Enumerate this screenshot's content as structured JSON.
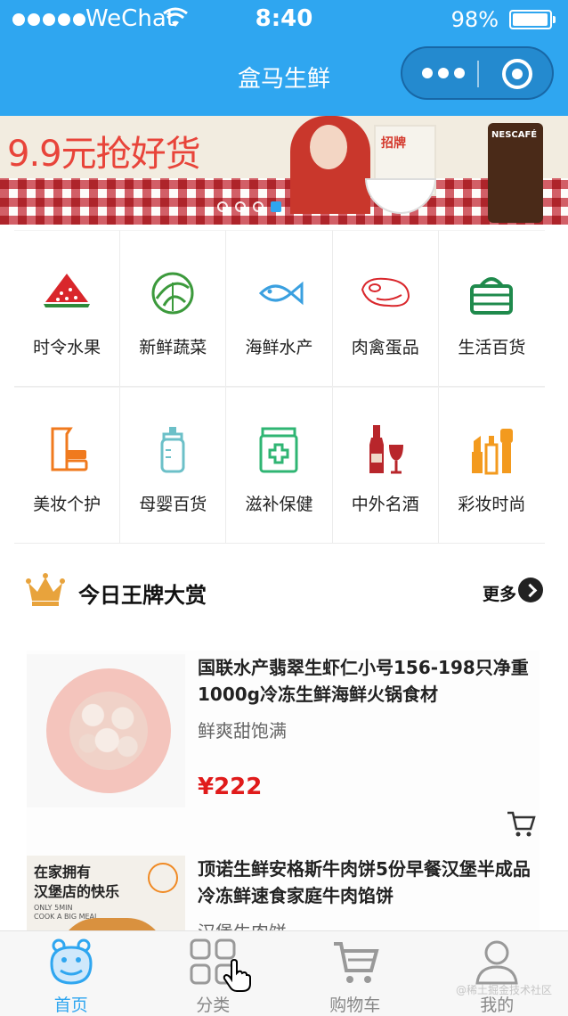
{
  "status_bar": {
    "carrier": "WeChat",
    "time": "8:40",
    "battery": "98%",
    "battery_level": 0.98
  },
  "nav": {
    "title": "盒马生鲜",
    "menu_icon": "more-dots-icon",
    "close_icon": "target-icon"
  },
  "banner": {
    "headline": "9.9元抢好货",
    "pack_text": "招牌",
    "jar_text": "NESCAFÉ",
    "slide_count": 4,
    "active_slide": 4
  },
  "categories": [
    {
      "label": "时令水果",
      "icon": "watermelon-icon",
      "color": "#d9262b"
    },
    {
      "label": "新鲜蔬菜",
      "icon": "cabbage-icon",
      "color": "#3c9a3c"
    },
    {
      "label": "海鲜水产",
      "icon": "fish-icon",
      "color": "#3aa0e0"
    },
    {
      "label": "肉禽蛋品",
      "icon": "meat-icon",
      "color": "#d9262b"
    },
    {
      "label": "生活百货",
      "icon": "basket-icon",
      "color": "#1f8a4c"
    },
    {
      "label": "美妆个护",
      "icon": "cosmetics-icon",
      "color": "#f07a1e"
    },
    {
      "label": "母婴百货",
      "icon": "baby-bottle-icon",
      "color": "#6cc0c8"
    },
    {
      "label": "滋补保健",
      "icon": "medicine-box-icon",
      "color": "#2fb573"
    },
    {
      "label": "中外名酒",
      "icon": "wine-icon",
      "color": "#b8262b"
    },
    {
      "label": "彩妆时尚",
      "icon": "lipstick-icon",
      "color": "#f39a1e"
    }
  ],
  "section": {
    "title": "今日王牌大赏",
    "more": "更多",
    "icon": "crown-icon"
  },
  "products": [
    {
      "title": "国联水产翡翠生虾仁小号156-198只净重1000g冷冻生鲜海鲜火锅食材",
      "subtitle": "鲜爽甜饱满",
      "price": "¥222"
    },
    {
      "title": "顶诺生鲜安格斯牛肉饼5份早餐汉堡半成品冷冻鲜速食家庭牛肉馅饼",
      "subtitle": "汉堡牛肉饼",
      "price": "",
      "thumb_text_1": "在家拥有",
      "thumb_text_2": "汉堡店的快乐",
      "thumb_text_3": "ONLY 5MIN",
      "thumb_text_4": "COOK A BIG MEAL"
    }
  ],
  "tabbar": [
    {
      "label": "首页",
      "icon": "hippo-icon",
      "active": true
    },
    {
      "label": "分类",
      "icon": "grid-icon",
      "active": false
    },
    {
      "label": "购物车",
      "icon": "cart-icon",
      "active": false
    },
    {
      "label": "我的",
      "icon": "user-icon",
      "active": false
    }
  ],
  "watermark": "@稀土掘金技术社区",
  "colors": {
    "brand_blue": "#2fa6f0",
    "price_red": "#e01b1b",
    "crown_gold": "#e8a33c"
  }
}
